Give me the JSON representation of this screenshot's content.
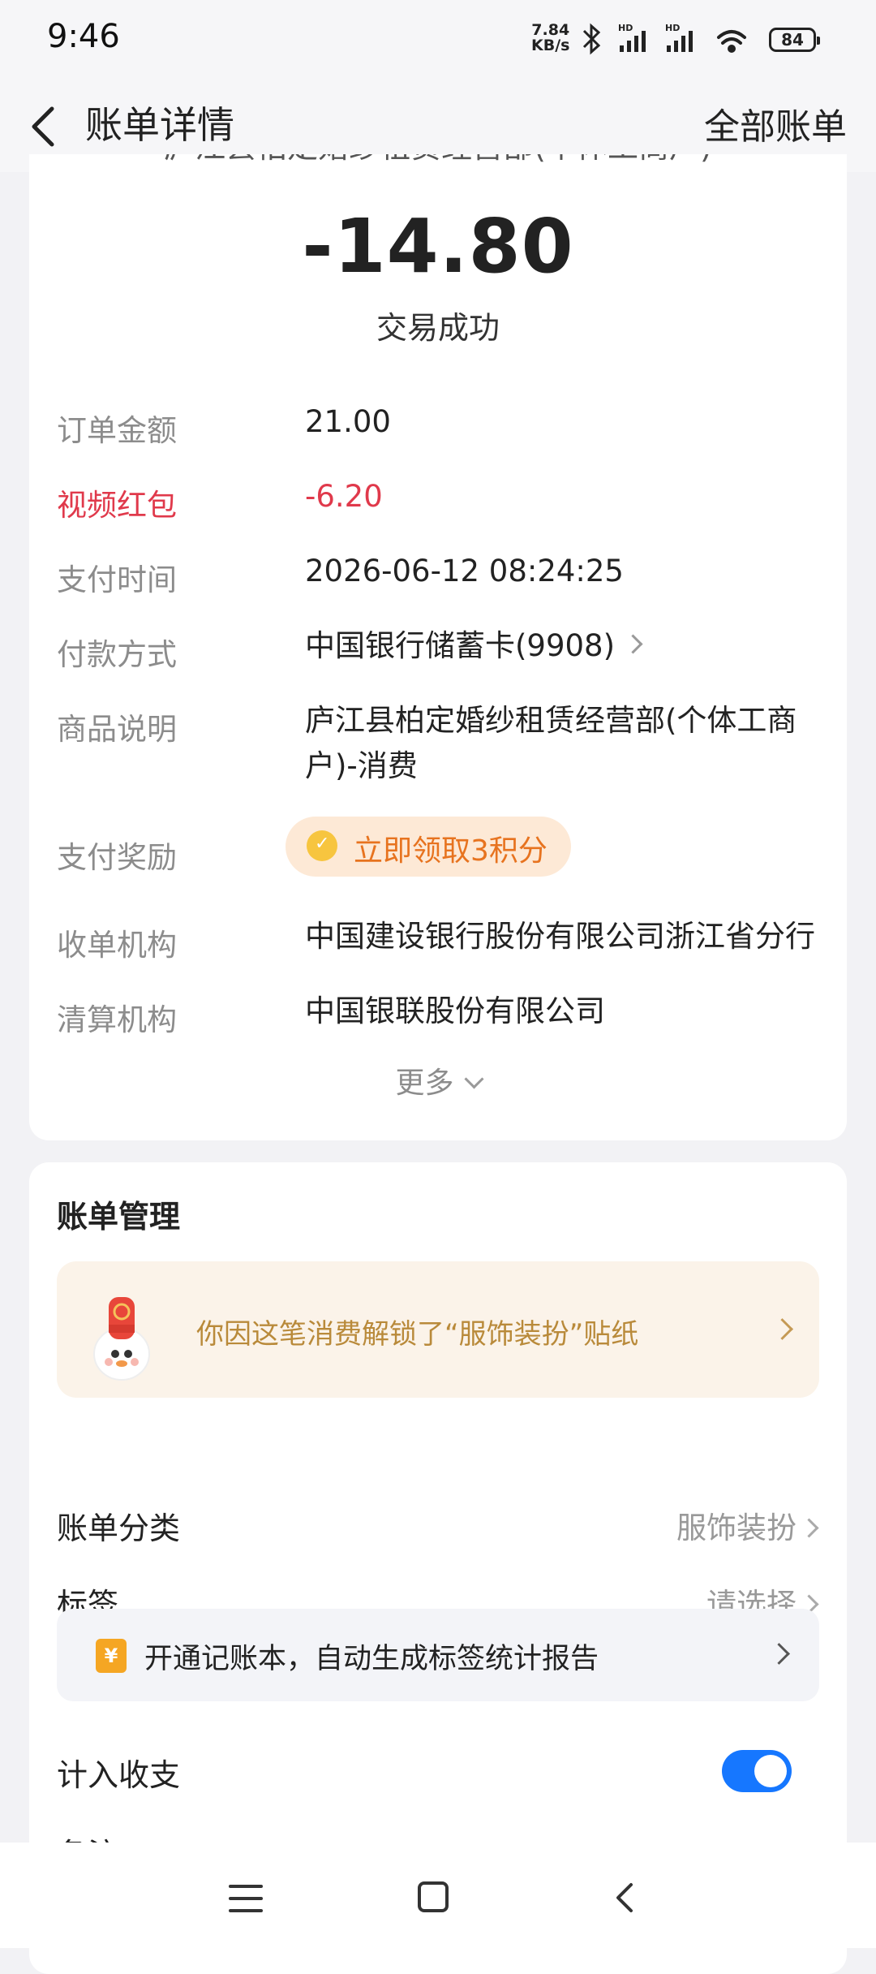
{
  "status_bar": {
    "time": "9:46",
    "net_speed_value": "7.84",
    "net_speed_unit": "KB/s",
    "battery": "84",
    "icons": [
      "bluetooth-icon",
      "hd-signal-icon",
      "hd-signal-icon",
      "wifi-icon",
      "battery-icon"
    ]
  },
  "nav": {
    "back_icon": "chevron-left-icon",
    "title": "账单详情",
    "right_link": "全部账单"
  },
  "summary": {
    "merchant_partial": "庐江县柏定婚纱租赁经营部(个体工商户)",
    "amount": "-14.80",
    "status": "交易成功"
  },
  "details": {
    "rows": [
      {
        "label": "订单金额",
        "value": "21.00"
      },
      {
        "label": "视频红包",
        "value": "-6.20"
      },
      {
        "label": "支付时间",
        "value": "2026-06-12 08:24:25"
      },
      {
        "label": "付款方式",
        "value": "中国银行储蓄卡(9908)"
      },
      {
        "label": "商品说明",
        "value": "庐江县柏定婚纱租赁经营部(个体工商户)-消费"
      },
      {
        "label": "支付奖励",
        "value": "立即领取3积分"
      },
      {
        "label": "收单机构",
        "value": "中国建设银行股份有限公司浙江省分行"
      },
      {
        "label": "清算机构",
        "value": "中国银联股份有限公司"
      }
    ],
    "more": "更多"
  },
  "management": {
    "title": "账单管理",
    "sticker_text": "你因这笔消费解锁了“服饰装扮”贴纸",
    "category_label": "账单分类",
    "category_value": "服饰装扮",
    "tag_label": "标签",
    "tag_value": "请选择",
    "ledger_icon_text": "¥",
    "ledger_text": "开通记账本，自动生成标签统计报告",
    "income_label": "计入收支",
    "income_enabled": true,
    "next_label_partial": "备注"
  },
  "colors": {
    "accent_blue": "#1677ff",
    "red": "#e0394b",
    "reward_orange": "#e7731f",
    "sticker_gold": "#b98a3a"
  }
}
